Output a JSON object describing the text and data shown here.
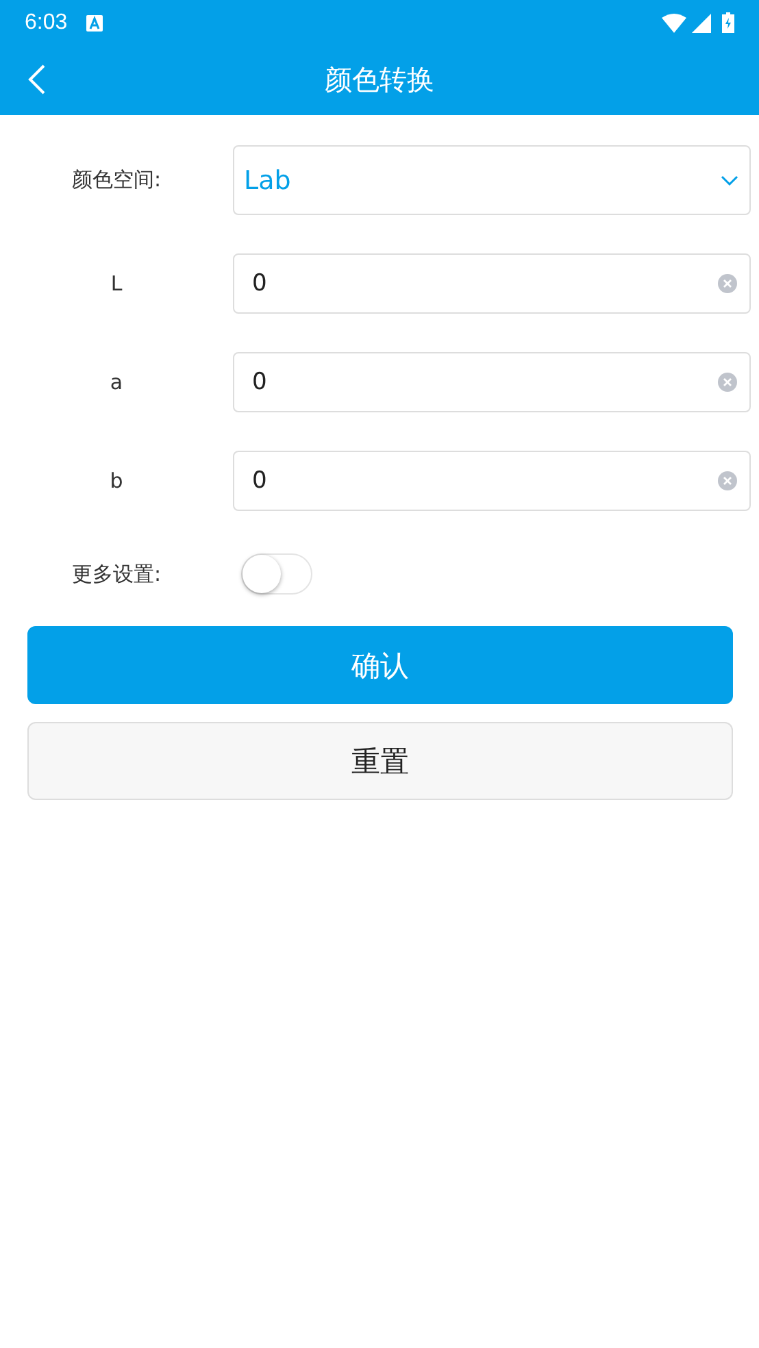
{
  "status_bar": {
    "time": "6:03"
  },
  "app_bar": {
    "title": "颜色转换"
  },
  "form": {
    "rows": [
      {
        "kind": "select",
        "label": "颜色空间:",
        "value": "Lab"
      },
      {
        "kind": "input",
        "label": "L",
        "value": "0"
      },
      {
        "kind": "input",
        "label": "a",
        "value": "0"
      },
      {
        "kind": "input",
        "label": "b",
        "value": "0"
      },
      {
        "kind": "switch",
        "label": "更多设置:",
        "on": false
      }
    ]
  },
  "buttons": [
    {
      "kind": "primary",
      "label": "确认"
    },
    {
      "kind": "secondary",
      "label": "重置"
    }
  ]
}
